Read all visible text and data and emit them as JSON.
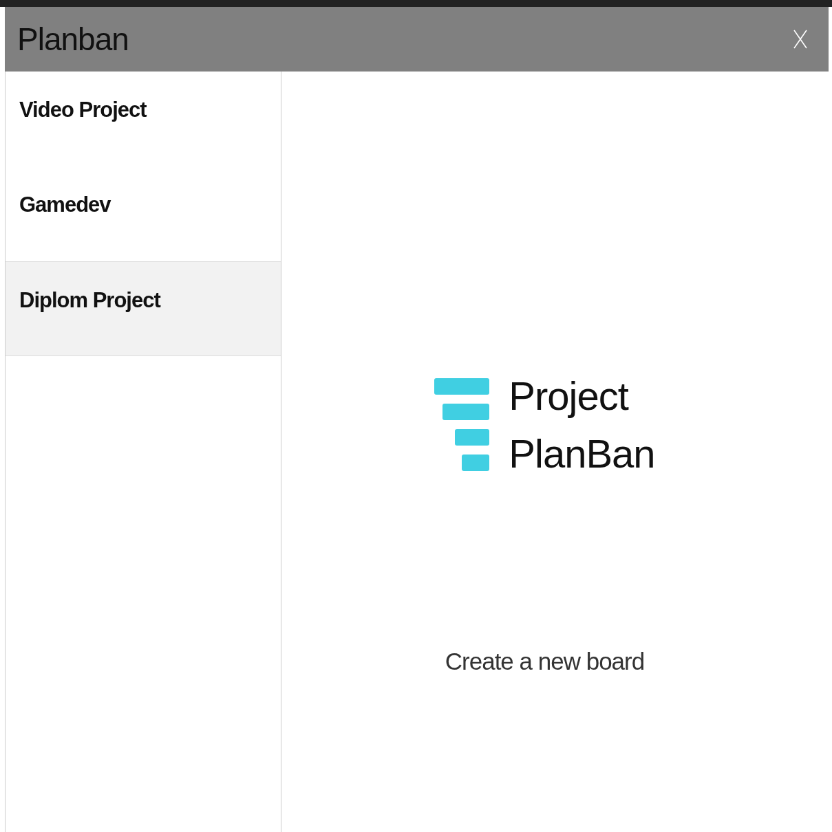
{
  "window": {
    "title": "Planban"
  },
  "sidebar": {
    "items": [
      {
        "label": "Video Project",
        "selected": false
      },
      {
        "label": "Gamedev",
        "selected": false
      },
      {
        "label": "Diplom Project",
        "selected": true
      }
    ]
  },
  "main": {
    "logo_lines": [
      "Project",
      "PlanBan"
    ],
    "action": "Create a new board"
  }
}
